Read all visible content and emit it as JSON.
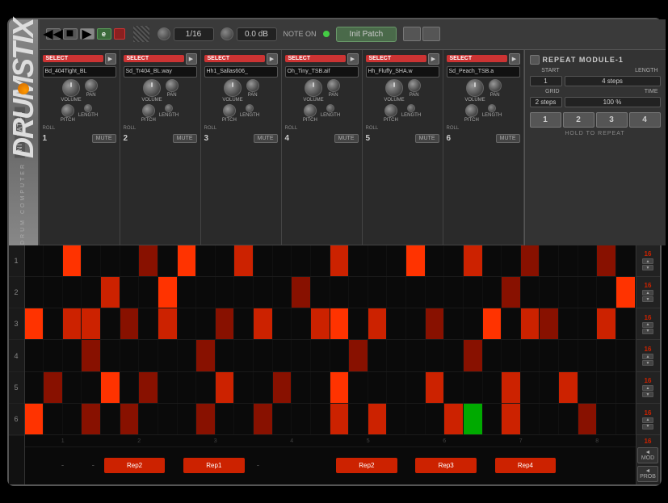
{
  "app": {
    "title": "DRUMSTIX",
    "subtitle": "DRUM COMPUTER",
    "init_patch_label": "INIT PATCH"
  },
  "header": {
    "note_on_label": "NOTE ON",
    "quantize_value": "1/16",
    "volume_value": "0.0 dB",
    "init_patch_btn": "Init Patch",
    "transport_btns": [
      "rew",
      "stop",
      "play",
      "rec"
    ],
    "e_btn": "e",
    "rec_btn_color": "#cc3333"
  },
  "channels": [
    {
      "id": 1,
      "name": "Bd_404Tight_BL",
      "num": "1"
    },
    {
      "id": 2,
      "name": "Sd_Tr404_BL.wav",
      "num": "2"
    },
    {
      "id": 3,
      "name": "Hh1_Sallas606_",
      "num": "3"
    },
    {
      "id": 4,
      "name": "Oh_Tiny_TSB.aif",
      "num": "4"
    },
    {
      "id": 5,
      "name": "Hh_Fluffy_SHA.w",
      "num": "5"
    },
    {
      "id": 6,
      "name": "Sd_Peach_TSB.a",
      "num": "6"
    }
  ],
  "repeat_module": {
    "title": "REPEAT MODULE-1",
    "start_label": "START",
    "start_value": "1",
    "length_label": "LENGTH",
    "length_value": "4 steps",
    "grid_label": "GRID",
    "grid_value": "2 steps",
    "time_label": "TIME",
    "time_value": "100 %",
    "hold_label": "HOLD TO REPEAT",
    "buttons": [
      "1",
      "2",
      "3",
      "4"
    ]
  },
  "side_values": [
    "16",
    "16",
    "16",
    "16",
    "16",
    "16"
  ],
  "pattern_numbers": [
    "1",
    "2",
    "3",
    "4",
    "5",
    "6",
    "7",
    "8"
  ],
  "pattern_labels": [
    {
      "text": "Rep2",
      "left_pct": 16
    },
    {
      "text": "Rep1",
      "left_pct": 29
    },
    {
      "text": "Rep2",
      "left_pct": 54
    },
    {
      "text": "Rep3",
      "left_pct": 67
    },
    {
      "text": "Rep4",
      "left_pct": 80
    }
  ],
  "bottom_buttons": {
    "mod": "◄ MOD",
    "prob": "◄ PROB"
  },
  "grid": {
    "rows": 6,
    "cols": 32
  }
}
